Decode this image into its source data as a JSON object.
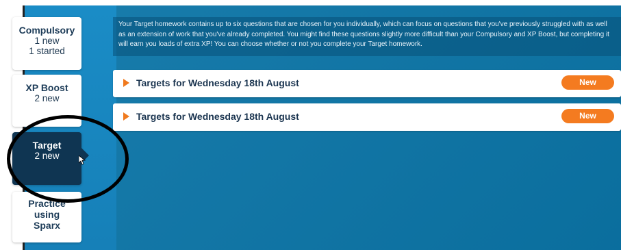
{
  "sidebar": {
    "items": [
      {
        "title": "Compulsory",
        "lines": [
          "1 new",
          "1 started"
        ]
      },
      {
        "title": "XP Boost",
        "lines": [
          "2 new"
        ]
      },
      {
        "title": "Target",
        "lines": [
          "2 new"
        ]
      },
      {
        "title": "Practice using Sparx",
        "lines": []
      }
    ]
  },
  "info_text": "Your Target homework contains up to six questions that are chosen for you individually, which can focus on questions that you've previously struggled with as well as an extension of work that you've already completed. You might find these questions slightly more difficult than your Compulsory and XP Boost, but completing it will earn you loads of extra XP! You can choose whether or not you complete your Target homework.",
  "rows": [
    {
      "label": "Targets for Wednesday 18th August",
      "badge": "New"
    },
    {
      "label": "Targets for Wednesday 18th August",
      "badge": "New"
    }
  ],
  "colors": {
    "accent": "#f47b20",
    "background": "#0b74a6",
    "active_tile": "#0f3552"
  }
}
